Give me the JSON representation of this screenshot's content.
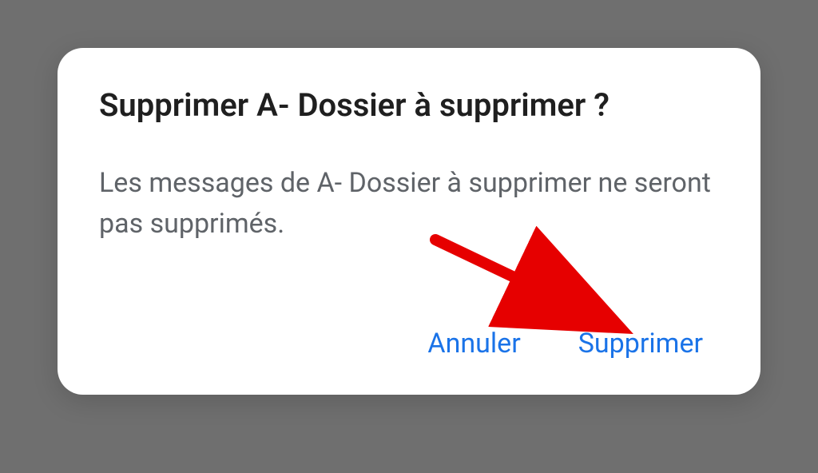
{
  "dialog": {
    "title": "Supprimer A- Dossier à supprimer ?",
    "body": "Les messages de A- Dossier à supprimer ne seront pas supprimés.",
    "cancel_label": "Annuler",
    "confirm_label": "Supprimer"
  }
}
